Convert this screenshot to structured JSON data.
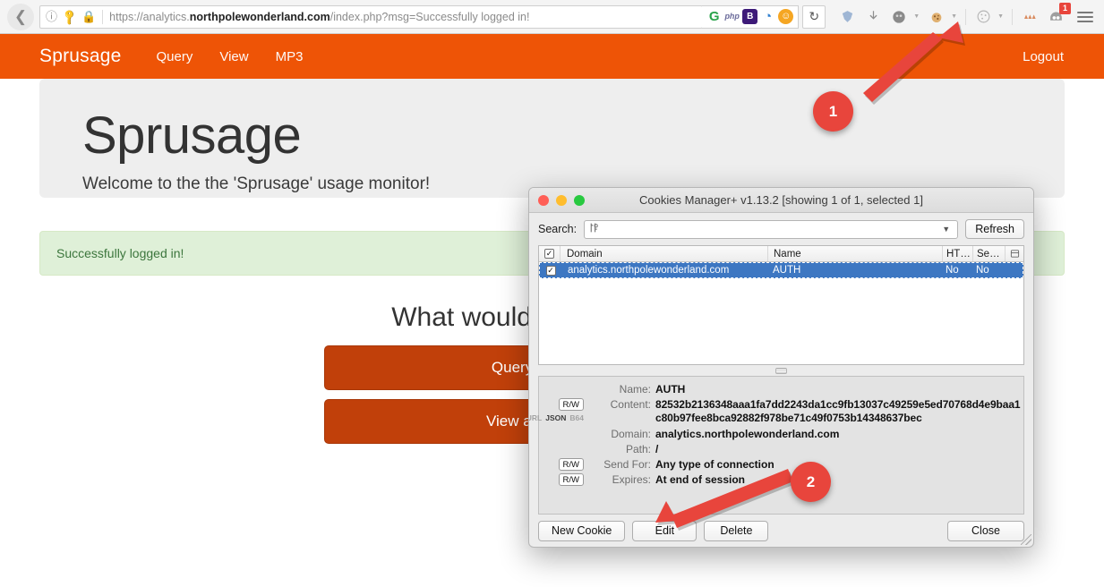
{
  "browser": {
    "back_icon": "back-arrow-icon",
    "identity_icon": "info-icon",
    "key_icon": "key-icon",
    "lock_icon": "padlock-icon",
    "url_prefix": "https://analytics.",
    "url_domain": "northpolewonderland.com",
    "url_suffix": "/index.php?msg=Successfully logged in!",
    "url_full": "https://analytics.northpolewonderland.com/index.php?msg=Successfully logged in!",
    "extensions": [
      {
        "name": "ghostery-icon",
        "glyph": "G"
      },
      {
        "name": "php-icon",
        "glyph": "php"
      },
      {
        "name": "bitwarden-icon",
        "glyph": "B"
      },
      {
        "name": "colorzilla-icon",
        "glyph": "◔"
      },
      {
        "name": "smile-icon",
        "glyph": "☺"
      }
    ],
    "reload_icon": "reload-icon",
    "toolbar_icons": [
      {
        "name": "pocket-icon",
        "glyph": "⬟"
      },
      {
        "name": "downloads-icon",
        "glyph": "⬇"
      },
      {
        "name": "user-profile-icon",
        "glyph": "●"
      },
      {
        "name": "cookie-icon",
        "glyph": "🍪"
      },
      {
        "name": "palette-icon",
        "glyph": "◎"
      },
      {
        "name": "extension-fox-icon",
        "glyph": "❖"
      },
      {
        "name": "cookies-manager-icon",
        "glyph": "◑"
      }
    ],
    "notification_count": "1",
    "menu_icon": "hamburger-menu-icon"
  },
  "site": {
    "brand": "Sprusage",
    "nav_links": [
      "Query",
      "View",
      "MP3"
    ],
    "logout_label": "Logout",
    "hero_title": "Sprusage",
    "hero_subtitle": "Welcome to the the 'Sprusage' usage monitor!",
    "alert_message": "Successfully logged in!",
    "prompt_heading": "What would you like to do?",
    "buttons": [
      {
        "label": "Query usage data"
      },
      {
        "label": "View all usage data"
      }
    ]
  },
  "dialog": {
    "title": "Cookies Manager+ v1.13.2 [showing 1 of 1, selected 1]",
    "traffic_lights": [
      "close",
      "minimize",
      "maximize"
    ],
    "search_label": "Search:",
    "search_value": "",
    "search_placeholder": "",
    "search_glyph": "⚙",
    "refresh_label": "Refresh",
    "columns": {
      "check": "✓",
      "domain": "Domain",
      "name": "Name",
      "http": "HT…",
      "secure": "Se…",
      "settings_icon": "column-settings-icon"
    },
    "rows": [
      {
        "checked": "✓",
        "domain": "analytics.northpolewonderland.com",
        "name": "AUTH",
        "http_only": "No",
        "secure": "No"
      }
    ],
    "details": {
      "name_label": "Name:",
      "name_value": "AUTH",
      "content_label": "Content:",
      "content_value": "82532b2136348aaa1fa7dd2243da1cc9fb13037c49259e5ed70768d4e9baa1c80b97fee8bca92882f978be71c49f0753b14348637bec",
      "domain_label": "Domain:",
      "domain_value": "analytics.northpolewonderland.com",
      "path_label": "Path:",
      "path_value": "/",
      "send_for_label": "Send For:",
      "send_for_value": "Any type of connection",
      "expires_label": "Expires:",
      "expires_value": "At end of session",
      "rw_chip": "R/W",
      "encoding_chips": [
        "URL",
        "JSON",
        "B64"
      ]
    },
    "footer_buttons": [
      {
        "label": "New Cookie",
        "name": "new-cookie-button"
      },
      {
        "label": "Edit",
        "name": "edit-button"
      },
      {
        "label": "Delete",
        "name": "delete-button"
      },
      {
        "label": "Close",
        "name": "close-button"
      }
    ]
  },
  "annotations": [
    {
      "number": "1",
      "target": "cookies-manager-toolbar-icon"
    },
    {
      "number": "2",
      "target": "edit-button"
    }
  ],
  "colors": {
    "navbar_orange": "#ee5406",
    "button_orange": "#c1400a",
    "alert_green_bg": "#dff0d8",
    "alert_green_text": "#3c763d",
    "callout_red": "#e8453c",
    "selection_blue": "#3d77c2"
  }
}
